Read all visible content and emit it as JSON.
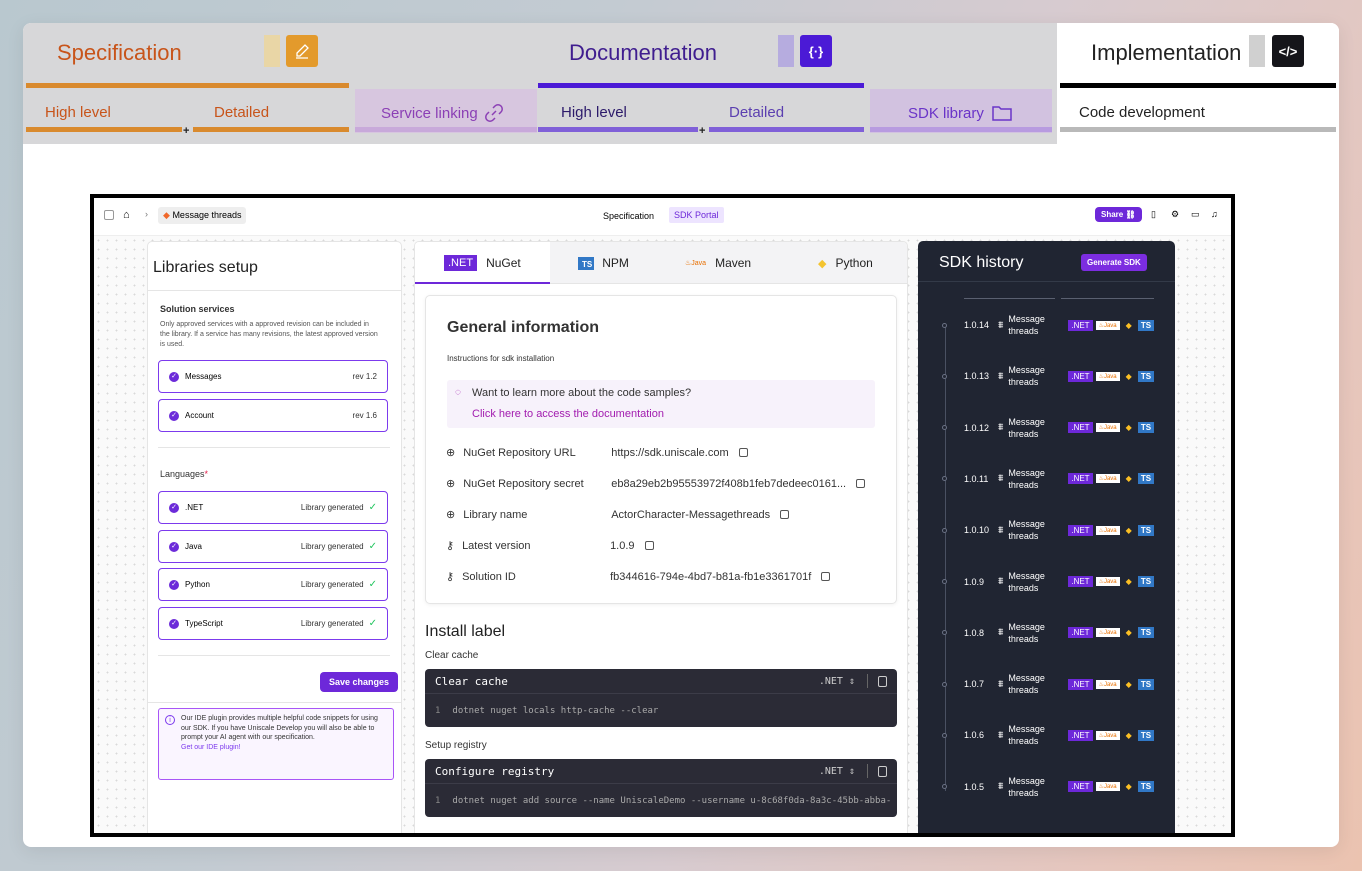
{
  "stages": {
    "specification": {
      "title": "Specification",
      "high": "High level",
      "detailed": "Detailed",
      "color": "#c8541a"
    },
    "service_linking": "Service linking",
    "documentation": {
      "title": "Documentation",
      "high": "High level",
      "detailed": "Detailed",
      "icon": "{·}"
    },
    "sdk_library": "SDK library",
    "implementation": {
      "title": "Implementation",
      "code": "Code development",
      "icon": "</>"
    },
    "plus": "+"
  },
  "app": {
    "breadcrumb": "Message threads",
    "center_tab": "Specification",
    "center_badge": "SDK Portal",
    "share": "Share"
  },
  "libraries": {
    "title": "Libraries setup",
    "services_heading": "Solution services",
    "services_desc": "Only approved services with a approved revision can be included in the library. If a service has many revisions, the latest approved version is used.",
    "services": [
      {
        "name": "Messages",
        "rev": "rev 1.2"
      },
      {
        "name": "Account",
        "rev": "rev 1.6"
      }
    ],
    "languages_heading": "Languages",
    "required_mark": "*",
    "languages": [
      {
        "name": ".NET",
        "status": "Library generated"
      },
      {
        "name": "Java",
        "status": "Library generated"
      },
      {
        "name": "Python",
        "status": "Library generated"
      },
      {
        "name": "TypeScript",
        "status": "Library generated"
      }
    ],
    "save": "Save changes",
    "plugin_note": "Our IDE plugin provides multiple helpful code snippets for using our SDK. If you have Uniscale Develop you will also be able to prompt your AI agent with our specification.",
    "plugin_link": "Get our IDE plugin!"
  },
  "tabs": [
    {
      "badge": ".NET",
      "label": "NuGet"
    },
    {
      "badge": "TS",
      "label": "NPM"
    },
    {
      "badge": "Java",
      "label": "Maven"
    },
    {
      "badge": "",
      "label": "Python"
    }
  ],
  "general": {
    "title": "General information",
    "instructions": "Instructions for sdk installation",
    "learn": "Want to learn more about the code samples?",
    "learn_link": "Click here to access the documentation",
    "fields": [
      {
        "key": "NuGet Repository URL",
        "value": "https://sdk.uniscale.com"
      },
      {
        "key": "NuGet Repository secret",
        "value": "eb8a29eb2b95553972f408b1feb7dedeec0161..."
      },
      {
        "key": "Library name",
        "value": "ActorCharacter-Messagethreads"
      },
      {
        "key": "Latest version",
        "value": "1.0.9"
      },
      {
        "key": "Solution ID",
        "value": "fb344616-794e-4bd7-b81a-fb1e3361701f"
      }
    ]
  },
  "install": {
    "title": "Install label",
    "blocks": [
      {
        "caption": "Clear cache",
        "header": "Clear cache",
        "lang": ".NET",
        "line": "1",
        "cmd": "dotnet nuget locals http-cache --clear"
      },
      {
        "caption": "Setup registry",
        "header": "Configure registry",
        "lang": ".NET",
        "line": "1",
        "cmd": "dotnet nuget add source --name UniscaleDemo --username u-8c68f0da-8a3c-45bb-abba-"
      }
    ]
  },
  "history": {
    "title": "SDK history",
    "generate": "Generate SDK",
    "name": "Message threads",
    "versions": [
      "1.0.14",
      "1.0.13",
      "1.0.12",
      "1.0.11",
      "1.0.10",
      "1.0.9",
      "1.0.8",
      "1.0.7",
      "1.0.6",
      "1.0.5"
    ]
  }
}
